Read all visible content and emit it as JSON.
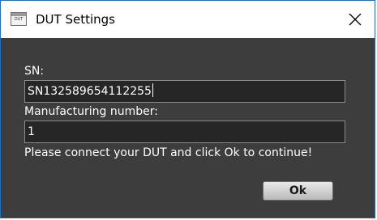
{
  "window": {
    "title": "DUT Settings",
    "app_icon_text": "DUT",
    "titlebar_color": "#ffffff",
    "body_color": "#3d3d3d"
  },
  "form": {
    "sn_label": "SN:",
    "sn_value": "SN132589654112255",
    "manufacturing_label": "Manufacturing number:",
    "manufacturing_value": "1",
    "instruction": "Please connect your DUT and click Ok to continue!",
    "ok_label": "Ok"
  },
  "icons": {
    "app": "dut-app-icon",
    "close": "close-icon"
  }
}
